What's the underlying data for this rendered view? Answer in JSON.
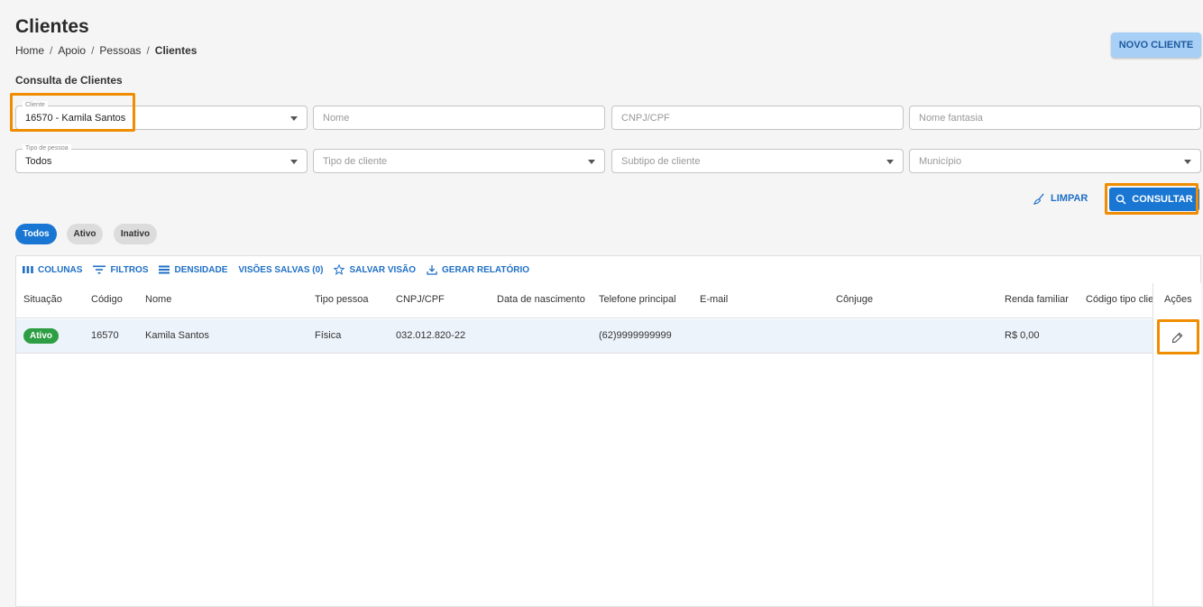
{
  "page": {
    "title": "Clientes",
    "breadcrumb": [
      "Home",
      "Apoio",
      "Pessoas",
      "Clientes"
    ],
    "new_button": "NOVO CLIENTE",
    "section_title": "Consulta de Clientes"
  },
  "filters": {
    "cliente": {
      "legend": "Cliente",
      "value": "16570 - Kamila Santos"
    },
    "nome": {
      "placeholder": "Nome"
    },
    "cnpj": {
      "placeholder": "CNPJ/CPF"
    },
    "nome_fantasia": {
      "placeholder": "Nome fantasia"
    },
    "tipo_pessoa": {
      "legend": "Tipo de pessoa",
      "value": "Todos"
    },
    "tipo_cliente": {
      "placeholder": "Tipo de cliente"
    },
    "subtipo_cliente": {
      "placeholder": "Subtipo de cliente"
    },
    "municipio": {
      "placeholder": "Município"
    }
  },
  "actions": {
    "clear": "LIMPAR",
    "search": "CONSULTAR"
  },
  "status_chips": [
    "Todos",
    "Ativo",
    "Inativo"
  ],
  "toolbar": {
    "columns": "COLUNAS",
    "filters": "FILTROS",
    "density": "DENSIDADE",
    "saved_views": "VISÕES SALVAS (0)",
    "save_view": "SALVAR VISÃO",
    "report": "GERAR RELATÓRIO"
  },
  "table": {
    "columns": [
      "Situação",
      "Código",
      "Nome",
      "Tipo pessoa",
      "CNPJ/CPF",
      "Data de nascimento",
      "Telefone principal",
      "E-mail",
      "Cônjuge",
      "Renda familiar",
      "Código tipo cliente",
      "Ações"
    ],
    "rows": [
      {
        "situacao": "Ativo",
        "codigo": "16570",
        "nome": "Kamila Santos",
        "tipo_pessoa": "Física",
        "cnpj": "032.012.820-22",
        "nascimento": "",
        "telefone": "(62)9999999999",
        "email": "",
        "conjuge": "",
        "renda": "R$ 0,00",
        "codigo_tipo": ""
      }
    ]
  },
  "colors": {
    "primary": "#1976d2",
    "highlight": "#f08c00",
    "status_active": "#2e9e44"
  }
}
